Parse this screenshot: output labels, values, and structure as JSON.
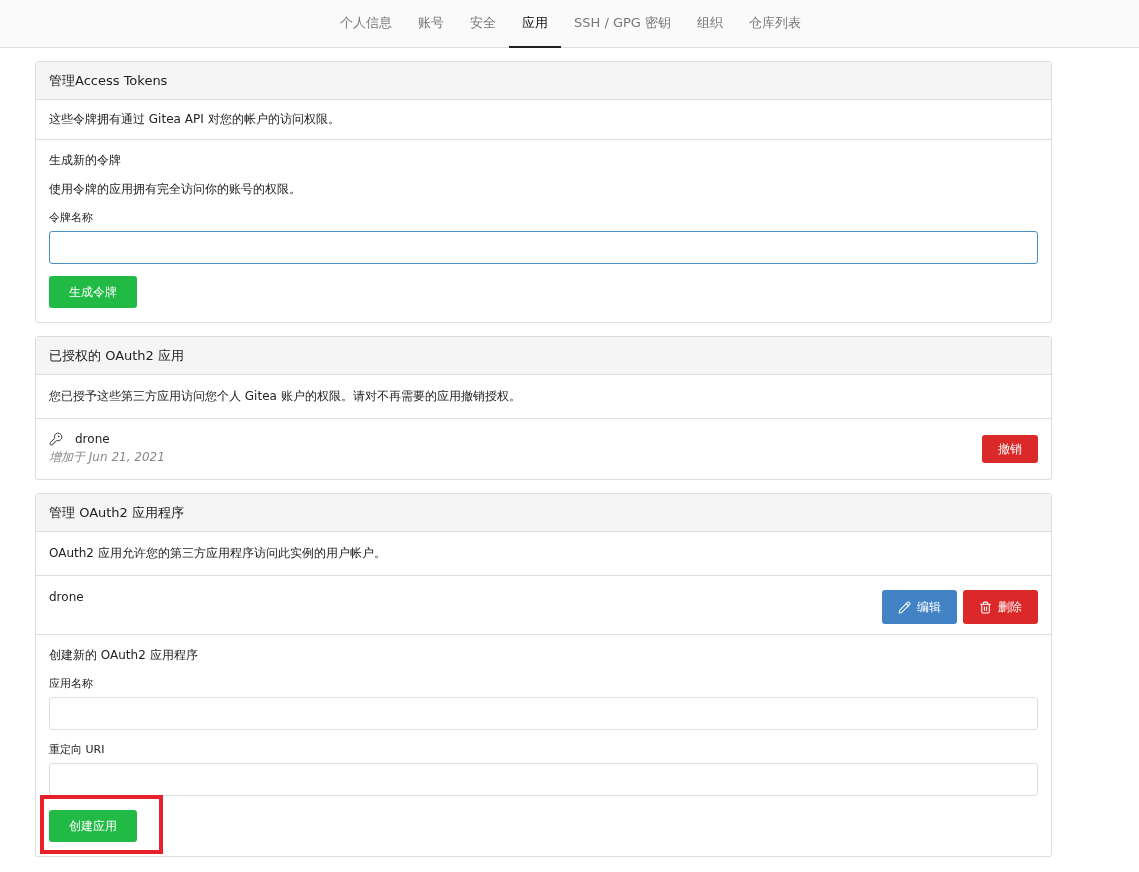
{
  "tabs": [
    {
      "label": "个人信息",
      "selected": false
    },
    {
      "label": "账号",
      "selected": false
    },
    {
      "label": "安全",
      "selected": false
    },
    {
      "label": "应用",
      "selected": true
    },
    {
      "label": "SSH / GPG 密钥",
      "selected": false
    },
    {
      "label": "组织",
      "selected": false
    },
    {
      "label": "仓库列表",
      "selected": false
    }
  ],
  "access_tokens": {
    "title": "管理Access Tokens",
    "description": "这些令牌拥有通过 Gitea API 对您的帐户的访问权限。",
    "form_title": "生成新的令牌",
    "form_note": "使用令牌的应用拥有完全访问你的账号的权限。",
    "field_label": "令牌名称",
    "field_focused": true,
    "button": "生成令牌"
  },
  "authorized_apps": {
    "title": "已授权的 OAuth2 应用",
    "description": "您已授予这些第三方应用访问您个人 Gitea 账户的权限。请对不再需要的应用撤销授权。",
    "items": [
      {
        "name": "drone",
        "added": "增加于 Jun 21, 2021",
        "button": "撤销"
      }
    ]
  },
  "oauth_apps": {
    "title": "管理 OAuth2 应用程序",
    "description": "OAuth2 应用允许您的第三方应用程序访问此实例的用户帐户。",
    "items": [
      {
        "name": "drone",
        "edit": "编辑",
        "delete": "删除"
      }
    ],
    "form_title": "创建新的 OAuth2 应用程序",
    "fields": [
      {
        "label": "应用名称"
      },
      {
        "label": "重定向 URI"
      }
    ],
    "button": "创建应用",
    "button_highlighted": true
  }
}
